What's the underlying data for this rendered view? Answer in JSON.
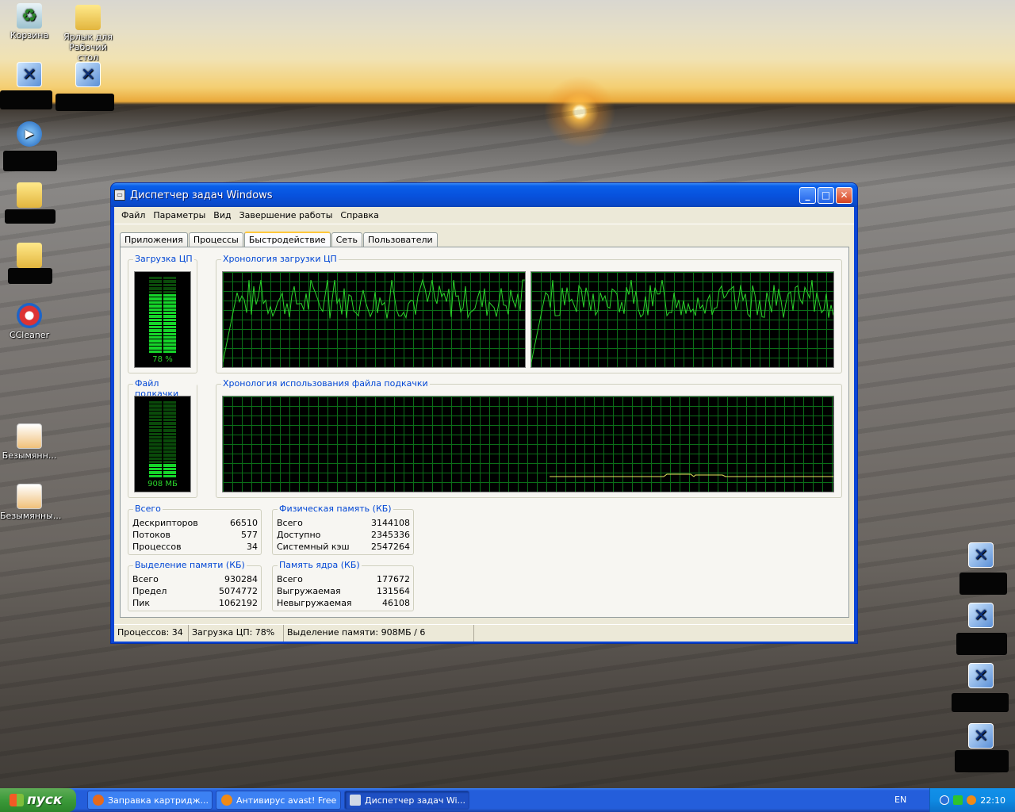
{
  "desktop": {
    "icons": [
      {
        "label": "Корзина",
        "icon": "recycle-bin-icon"
      },
      {
        "label": "Ярлык для Рабочий стол",
        "icon": "folder-shortcut-icon"
      },
      {
        "label": "CCleaner",
        "icon": "ccleaner-icon"
      },
      {
        "label": "Безымянн...",
        "icon": "image-file-icon"
      },
      {
        "label": "Безымянны...",
        "icon": "image-file-icon"
      }
    ]
  },
  "window": {
    "title": "Диспетчер задач Windows",
    "menu": [
      "Файл",
      "Параметры",
      "Вид",
      "Завершение работы",
      "Справка"
    ],
    "tabs": [
      "Приложения",
      "Процессы",
      "Быстродействие",
      "Сеть",
      "Пользователи"
    ],
    "active_tab": "Быстродействие",
    "groups": {
      "cpu_usage": {
        "label": "Загрузка ЦП",
        "value_text": "78 %",
        "level": 0.78
      },
      "cpu_history": {
        "label": "Хронология загрузки ЦП"
      },
      "pagefile": {
        "label": "Файл подкачки",
        "value_text": "908 МБ",
        "level": 0.18
      },
      "pagefile_history": {
        "label": "Хронология использования файла подкачки"
      }
    },
    "totals": {
      "label": "Всего",
      "rows": [
        {
          "k": "Дескрипторов",
          "v": "66510"
        },
        {
          "k": "Потоков",
          "v": "577"
        },
        {
          "k": "Процессов",
          "v": "34"
        }
      ]
    },
    "physical": {
      "label": "Физическая память (КБ)",
      "rows": [
        {
          "k": "Всего",
          "v": "3144108"
        },
        {
          "k": "Доступно",
          "v": "2345336"
        },
        {
          "k": "Системный кэш",
          "v": "2547264"
        }
      ]
    },
    "commit": {
      "label": "Выделение памяти (КБ)",
      "rows": [
        {
          "k": "Всего",
          "v": "930284"
        },
        {
          "k": "Предел",
          "v": "5074772"
        },
        {
          "k": "Пик",
          "v": "1062192"
        }
      ]
    },
    "kernel": {
      "label": "Память ядра (КБ)",
      "rows": [
        {
          "k": "Всего",
          "v": "177672"
        },
        {
          "k": "Выгружаемая",
          "v": "131564"
        },
        {
          "k": "Невыгружаемая",
          "v": "46108"
        }
      ]
    },
    "status": [
      "Процессов: 34",
      "Загрузка ЦП: 78%",
      "Выделение памяти: 908МБ / 6"
    ]
  },
  "taskbar": {
    "start_label": "пуск",
    "tasks": [
      {
        "label": "Заправка картридж...",
        "icon": "firefox-icon",
        "color": "#e66a1c"
      },
      {
        "label": "Антивирус avast! Free",
        "icon": "avast-icon",
        "color": "#f08a16"
      },
      {
        "label": "Диспетчер задач Wi...",
        "icon": "task-manager-icon",
        "color": "#cfd8e6"
      }
    ],
    "lang": "EN",
    "clock": "22:10"
  },
  "colors": {
    "graph_line": "#2bd42b",
    "graph_grid": "#0b6e18",
    "titlebar": "#0a52de",
    "taskbar": "#245edb"
  }
}
